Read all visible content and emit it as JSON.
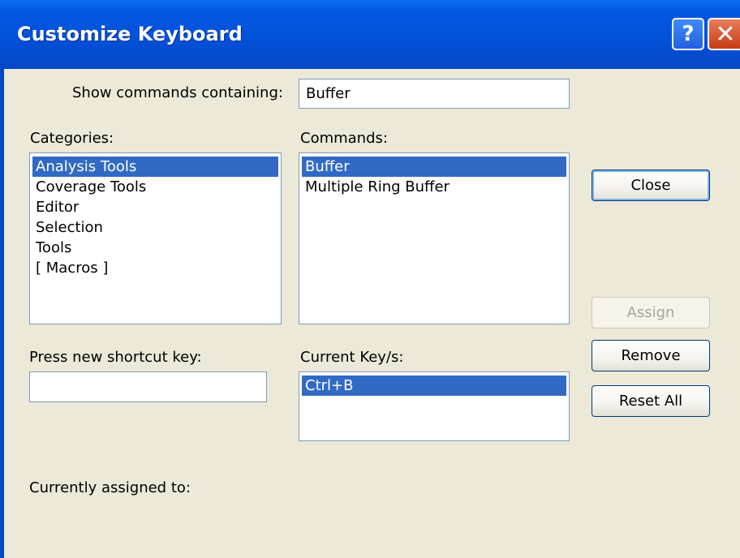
{
  "window": {
    "title": "Customize Keyboard",
    "help_glyph": "?",
    "close_glyph": "✕"
  },
  "search": {
    "label": "Show commands containing:",
    "value": "Buffer"
  },
  "categories": {
    "label": "Categories:",
    "items": [
      "Analysis Tools",
      "Coverage Tools",
      "Editor",
      "Selection",
      "Tools",
      "[ Macros ]"
    ],
    "selected": "Analysis Tools"
  },
  "commands": {
    "label": "Commands:",
    "items": [
      "Buffer",
      "Multiple Ring Buffer"
    ],
    "selected": "Buffer"
  },
  "shortcut": {
    "label": "Press new shortcut key:",
    "value": ""
  },
  "current_keys": {
    "label": "Current Key/s:",
    "items": [
      "Ctrl+B"
    ],
    "selected": "Ctrl+B"
  },
  "assigned": {
    "label": "Currently assigned to:"
  },
  "buttons": {
    "close": "Close",
    "assign": "Assign",
    "remove": "Remove",
    "reset_all": "Reset All"
  },
  "colors": {
    "titlebar": "#0458e0",
    "face": "#ece9d8",
    "selection": "#316ac5",
    "field_border": "#7f9db9"
  }
}
